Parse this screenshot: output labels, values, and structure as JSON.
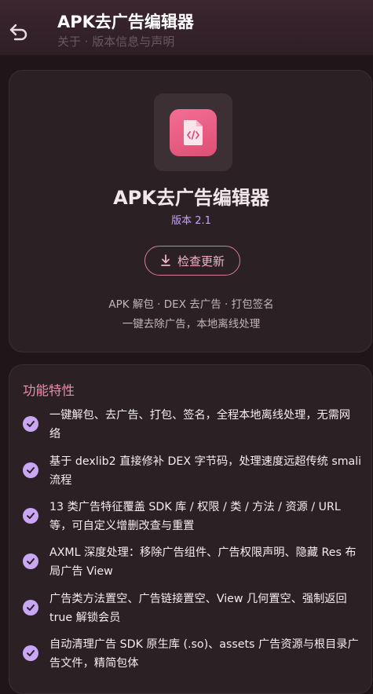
{
  "appbar": {
    "title": "APK去广告编辑器",
    "subtitle": "关于 · 版本信息与声明",
    "back_icon": "back-arrow-icon"
  },
  "about_card": {
    "logo_icon": "code-file-icon",
    "app_name": "APK去广告编辑器",
    "version": "版本 2.1",
    "update_button_label": "检查更新",
    "update_icon": "download-icon",
    "desc_line1": "APK 解包 · DEX 去广告 · 打包签名",
    "desc_line2": "一键去除广告，本地离线处理"
  },
  "features": {
    "title": "功能特性",
    "items": [
      {
        "line1": "一键解包、去广告、打包、签名，全程本地离线处理，无需网",
        "line2": "络"
      },
      {
        "line1": "基于 dexlib2 直接修补 DEX 字节码，处理速度远超传统 smali",
        "line2": "流程"
      },
      {
        "line1": "13 类广告特征覆盖 SDK 库 / 权限 / 类 / 方法 / 资源 / URL",
        "line2": "等，可自定义增删改查与重置"
      },
      {
        "line1": "AXML 深度处理：移除广告组件、广告权限声明、隐藏 Res 布",
        "line2": "局广告 View"
      },
      {
        "line1": "广告类方法置空、广告链接置空、View 几何置空、强制返回",
        "line2": "true 解锁会员"
      },
      {
        "line1": "自动清理广告 SDK 原生库 (.so)、assets 广告资源与根目录广",
        "line2": "告文件，精简包体"
      }
    ]
  },
  "colors": {
    "background": "#1e1618",
    "card": "#2b2125",
    "accent_pink": "#f08aaa",
    "accent_purple": "#c9a6f6"
  }
}
